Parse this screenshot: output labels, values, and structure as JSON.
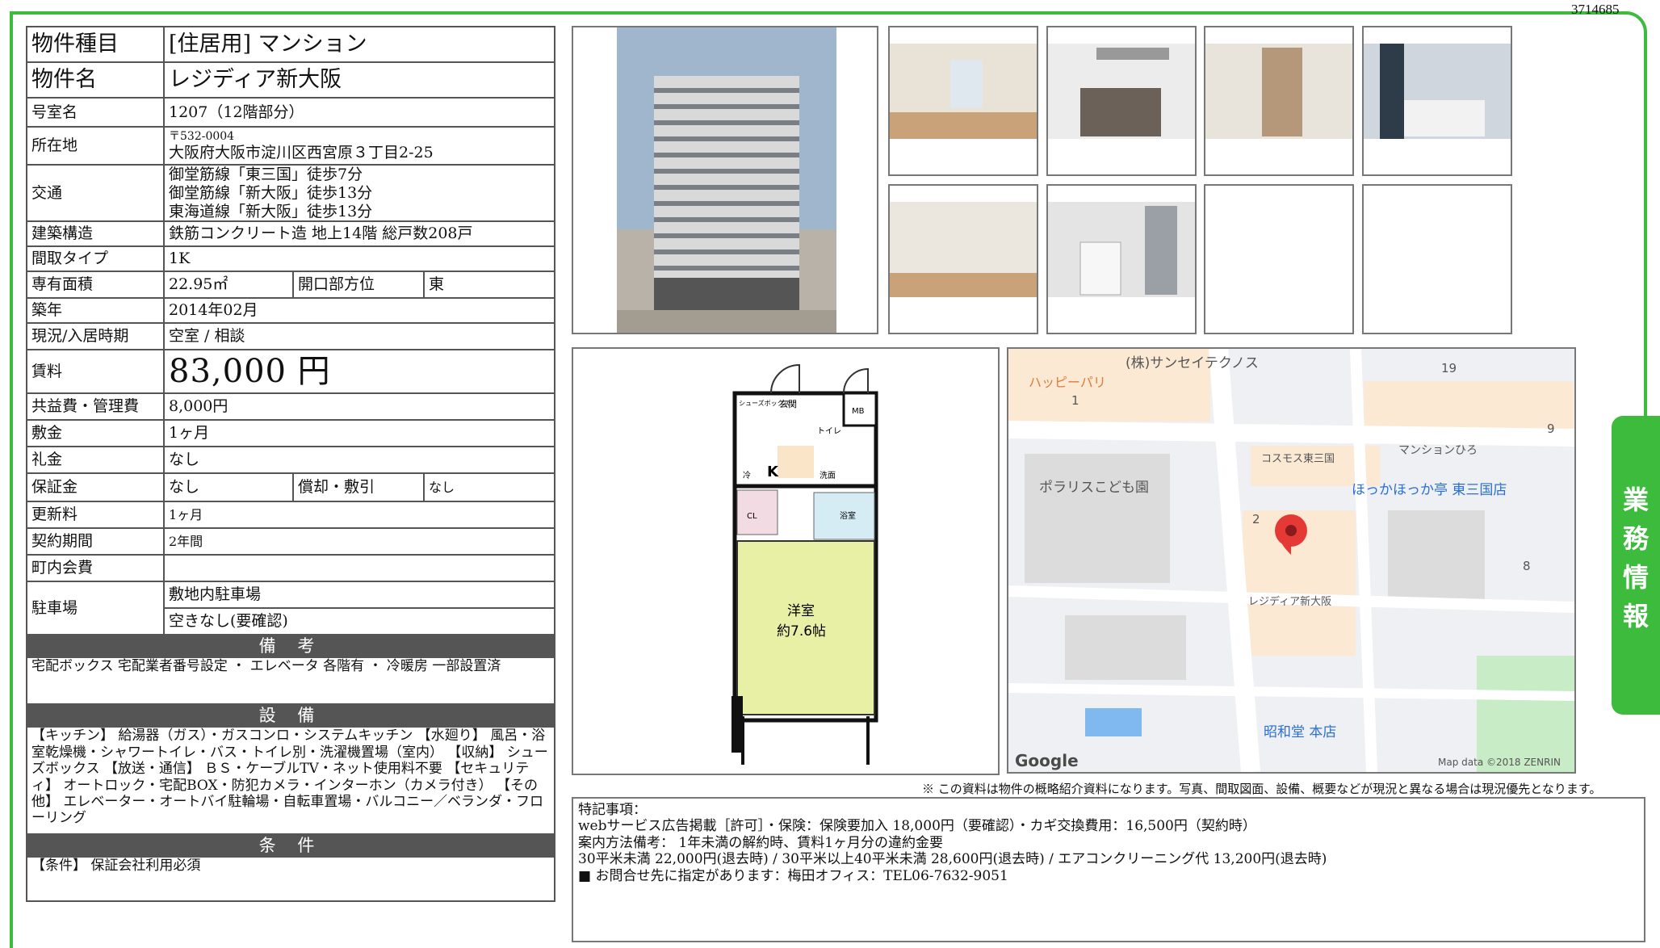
{
  "doc_id": "3714685",
  "rows": {
    "type_label": "物件種目",
    "type_value": "[住居用] マンション",
    "name_label": "物件名",
    "name_value": "レジディア新大阪",
    "room_label": "号室名",
    "room_value": "1207（12階部分）",
    "address_label": "所在地",
    "postal": "〒532-0004",
    "address_value": "大阪府大阪市淀川区西宮原３丁目2-25",
    "access_label": "交通",
    "access_1": "御堂筋線「東三国」徒歩7分",
    "access_2": "御堂筋線「新大阪」徒歩13分",
    "access_3": "東海道線「新大阪」徒歩13分",
    "structure_label": "建築構造",
    "structure_value": "鉄筋コンクリート造 地上14階 総戸数208戸",
    "layout_label": "間取タイプ",
    "layout_value": "1K",
    "area_label": "専有面積",
    "area_value": "22.95㎡",
    "direction_label": "開口部方位",
    "direction_value": "東",
    "built_label": "築年",
    "built_value": "2014年02月",
    "status_label": "現況/入居時期",
    "status_value": "空室 / 相談",
    "rent_label": "賃料",
    "rent_value": "83,000 円",
    "fee_label": "共益費・管理費",
    "fee_value": "8,000円",
    "deposit_label": "敷金",
    "deposit_value": "1ヶ月",
    "key_label": "礼金",
    "key_value": "なし",
    "guarantee_label": "保証金",
    "guarantee_value": "なし",
    "amort_label": "償却・敷引",
    "amort_value": "なし",
    "renew_label": "更新料",
    "renew_value": "1ヶ月",
    "term_label": "契約期間",
    "term_value": "2年間",
    "town_label": "町内会費",
    "town_value": "",
    "parking_label": "駐車場",
    "parking_1": "敷地内駐車場",
    "parking_2": "空きなし(要確認)"
  },
  "remarks_head": "備 考",
  "remarks_text": "宅配ボックス 宅配業者番号設定 ・ エレベータ 各階有 ・ 冷暖房 一部設置済",
  "equip_head": "設 備",
  "equip_text": "【キッチン】 給湯器（ガス）・ガスコンロ・システムキッチン 【水廻り】 風呂・浴室乾燥機・シャワートイレ・バス・トイレ別・洗濯機置場（室内） 【収納】 シューズボックス 【放送・通信】 ＢＳ・ケーブルTV・ネット使用料不要 【セキュリティ】 オートロック・宅配BOX・防犯カメラ・インターホン（カメラ付き） 【その他】 エレベーター・オートバイ駐輪場・自転車置場・バルコニー／ベランダ・フローリング",
  "cond_head": "条 件",
  "cond_text": "【条件】 保証会社利用必須",
  "floorplan": {
    "genkan": "玄関",
    "mb": "MB",
    "shoes": "シューズボックス",
    "toilet": "トイレ",
    "k": "K",
    "wash": "洗面",
    "fridge": "冷",
    "cl": "CL",
    "bath": "浴室",
    "room": "洋室",
    "room_size": "約7.6帖"
  },
  "map": {
    "l1": "(株)サンセイテクノス",
    "l2": "ハッピーパリ",
    "l3": "マンションひろ",
    "l4": "コスモス東三国",
    "l5": "ポラリスこども園",
    "l6": "ほっかほっか亭 東三国店",
    "l7": "レジディア新大阪",
    "l8": "昭和堂 本店",
    "n19": "19",
    "n1": "1",
    "n9": "9",
    "n2": "2",
    "n8": "8",
    "google": "Google",
    "credit": "Map data ©2018 ZENRIN"
  },
  "disclaimer": "※ この資料は物件の概略紹介資料になります。写真、間取図面、設備、概要などが現況と異なる場合は現況優先となります。",
  "tokki": {
    "head": "特記事項：",
    "line1": "webサービス広告掲載［許可］・保険：保険要加入 18,000円（要確認）・カギ交換費用：16,500円（契約時）",
    "line2": "案内方法備考： 1年未満の解約時、賃料1ヶ月分の違約金要",
    "line3": "30平米未満 22,000円(退去時) / 30平米以上40平米未満 28,600円(退去時) / エアコンクリーニング代 13,200円(退去時)",
    "line4": "■ お問合せ先に指定があります：梅田オフィス：TEL06-7632-9051"
  },
  "tab_text": "業務情報"
}
